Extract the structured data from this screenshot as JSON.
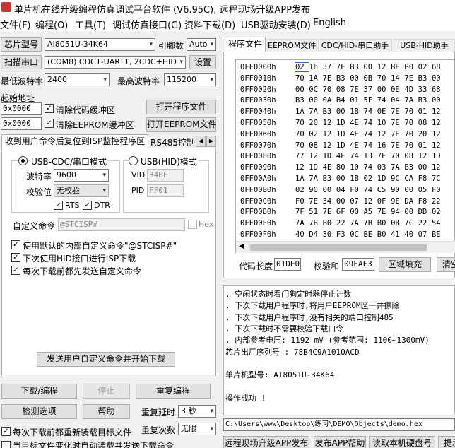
{
  "window": {
    "title": "单片机在线升级编程仿真调试平台软件 (V6.95C), 远程现场升级APP发布"
  },
  "menu": [
    "文件(F)",
    "编程(O)",
    "工具(T)",
    "调试仿真接口(G)",
    "资料下载(D)",
    "USB驱动安装(D)",
    "English"
  ],
  "left": {
    "chip_label": "芯片型号",
    "chip_value": "AI8051U-34K64",
    "pin_label": "引脚数",
    "pin_value": "Auto",
    "scan_button": "扫描串口",
    "port_value": "(COM8) CDC1-UART1, 2CDC+HID",
    "settings_button": "设置",
    "min_baud_label": "最低波特率",
    "min_baud_value": "2400",
    "max_baud_label": "最高波特率",
    "max_baud_value": "115200",
    "start_addr_label": "起始地址",
    "addr1": "0x0000",
    "clear_code_label": "清除代码缓冲区",
    "open_prog_button": "打开程序文件",
    "addr2": "0x0000",
    "clear_eeprom_label": "清除EEPROM缓冲区",
    "open_eeprom_button": "打开EEPROM文件",
    "tabs": [
      "收到用户命令后复位到ISP监控程序区",
      "RS485控制"
    ],
    "usb_cdc_label": "USB-CDC/串口模式",
    "usb_hid_label": "USB(HID)模式",
    "baud_label": "波特率",
    "baud_value": "9600",
    "parity_label": "校验位",
    "parity_value": "无校验",
    "vid_label": "VID",
    "vid_value": "34BF",
    "pid_label": "PID",
    "pid_value": "FF01",
    "rts_label": "RTS",
    "dtr_label": "DTR",
    "custom_cmd_label": "自定义命令",
    "custom_cmd_value": "@STCISP#",
    "hex_label": "Hex",
    "opt1": "使用默认的内部自定义命令\"@STCISP#\"",
    "opt2": "下次使用HID接口进行ISP下载",
    "opt3": "每次下载前都先发送自定义命令",
    "send_button": "发送用户自定义命令并开始下载",
    "download_button": "下载/编程",
    "stop_button": "停止",
    "reprogram_button": "重复编程",
    "check_button": "检测选项",
    "help_button": "帮助",
    "repeat_delay_label": "重复延时",
    "repeat_delay_value": "3 秒",
    "reload_label": "每次下载前都重新装载目标文件",
    "repeat_count_label": "重复次数",
    "repeat_count_value": "无限",
    "auto_load_label": "当目标文件变化时自动装载并发送下载命令"
  },
  "right": {
    "tabs": [
      "程序文件",
      "EEPROM文件",
      "CDC/HID-串口助手",
      "USB-HID助手"
    ],
    "hex_rows": [
      {
        "addr": "0FF0000h",
        "bytes": [
          "02",
          "16",
          "37",
          "7E",
          "B3",
          "00",
          "12",
          "BE",
          "B0",
          "02",
          "68"
        ]
      },
      {
        "addr": "0FF0010h",
        "bytes": [
          "70",
          "1A",
          "7E",
          "B3",
          "00",
          "0B",
          "70",
          "14",
          "7E",
          "B3",
          "00"
        ]
      },
      {
        "addr": "0FF0020h",
        "bytes": [
          "00",
          "0C",
          "70",
          "08",
          "7E",
          "37",
          "00",
          "0E",
          "4D",
          "33",
          "68"
        ]
      },
      {
        "addr": "0FF0030h",
        "bytes": [
          "B3",
          "00",
          "0A",
          "B4",
          "01",
          "5F",
          "74",
          "04",
          "7A",
          "B3",
          "00"
        ]
      },
      {
        "addr": "0FF0040h",
        "bytes": [
          "1A",
          "7A",
          "B3",
          "00",
          "1B",
          "74",
          "0E",
          "7E",
          "70",
          "01",
          "12"
        ]
      },
      {
        "addr": "0FF0050h",
        "bytes": [
          "70",
          "20",
          "12",
          "1D",
          "4E",
          "74",
          "10",
          "7E",
          "70",
          "08",
          "12"
        ]
      },
      {
        "addr": "0FF0060h",
        "bytes": [
          "70",
          "02",
          "12",
          "1D",
          "4E",
          "74",
          "12",
          "7E",
          "70",
          "20",
          "12"
        ]
      },
      {
        "addr": "0FF0070h",
        "bytes": [
          "70",
          "08",
          "12",
          "1D",
          "4E",
          "74",
          "16",
          "7E",
          "70",
          "01",
          "12"
        ]
      },
      {
        "addr": "0FF0080h",
        "bytes": [
          "77",
          "12",
          "1D",
          "4E",
          "74",
          "13",
          "7E",
          "70",
          "08",
          "12",
          "1D"
        ]
      },
      {
        "addr": "0FF0090h",
        "bytes": [
          "12",
          "1D",
          "4E",
          "80",
          "10",
          "74",
          "03",
          "7A",
          "B3",
          "00",
          "12"
        ]
      },
      {
        "addr": "0FF00A0h",
        "bytes": [
          "1A",
          "7A",
          "B3",
          "00",
          "1B",
          "02",
          "1D",
          "9C",
          "CA",
          "F8",
          "7C"
        ]
      },
      {
        "addr": "0FF00B0h",
        "bytes": [
          "02",
          "90",
          "00",
          "04",
          "F0",
          "74",
          "C5",
          "90",
          "00",
          "05",
          "F0"
        ]
      },
      {
        "addr": "0FF00C0h",
        "bytes": [
          "F0",
          "7E",
          "34",
          "00",
          "07",
          "12",
          "0F",
          "9E",
          "DA",
          "F8",
          "22"
        ]
      },
      {
        "addr": "0FF00D0h",
        "bytes": [
          "7F",
          "51",
          "7E",
          "6F",
          "00",
          "A5",
          "7E",
          "94",
          "00",
          "DD",
          "02"
        ]
      },
      {
        "addr": "0FF00E0h",
        "bytes": [
          "7A",
          "7B",
          "B0",
          "22",
          "7A",
          "7B",
          "B0",
          "0B",
          "7C",
          "22",
          "54"
        ]
      },
      {
        "addr": "0FF00F0h",
        "bytes": [
          "40",
          "D4",
          "30",
          "F3",
          "0C",
          "BE",
          "B0",
          "41",
          "40",
          "07",
          "BE"
        ]
      }
    ],
    "code_len_label": "代码长度",
    "code_len_value": "01DE0",
    "checksum_label": "校验和",
    "checksum_value": "09FAF3",
    "fill_button": "区域填充",
    "clear_button": "清空",
    "log": [
      ". 空闲状态时看门狗定时器停止计数",
      ". 下次下载用户程序时,将用户EEPROM区一并擦除",
      ". 下次下载用户程序时,没有相关的端口控制485",
      ". 下次下载时不需要校验下载口令",
      ". 内部参考电压: 1192 mV (参考范围: 1100~1300mV)",
      "芯片出厂序列号 : 78B4C9A1010ACD",
      "",
      "  单片机型号: AI8051U-34K64",
      "",
      "操作成功 !"
    ],
    "file_path": "C:\\Users\\www\\Desktop\\练习\\DEMO\\Objects\\demo.hex",
    "bottom_buttons": [
      "远程现场升级APP发布",
      "发布APP帮助",
      "读取本机硬盘号",
      "提示"
    ]
  }
}
